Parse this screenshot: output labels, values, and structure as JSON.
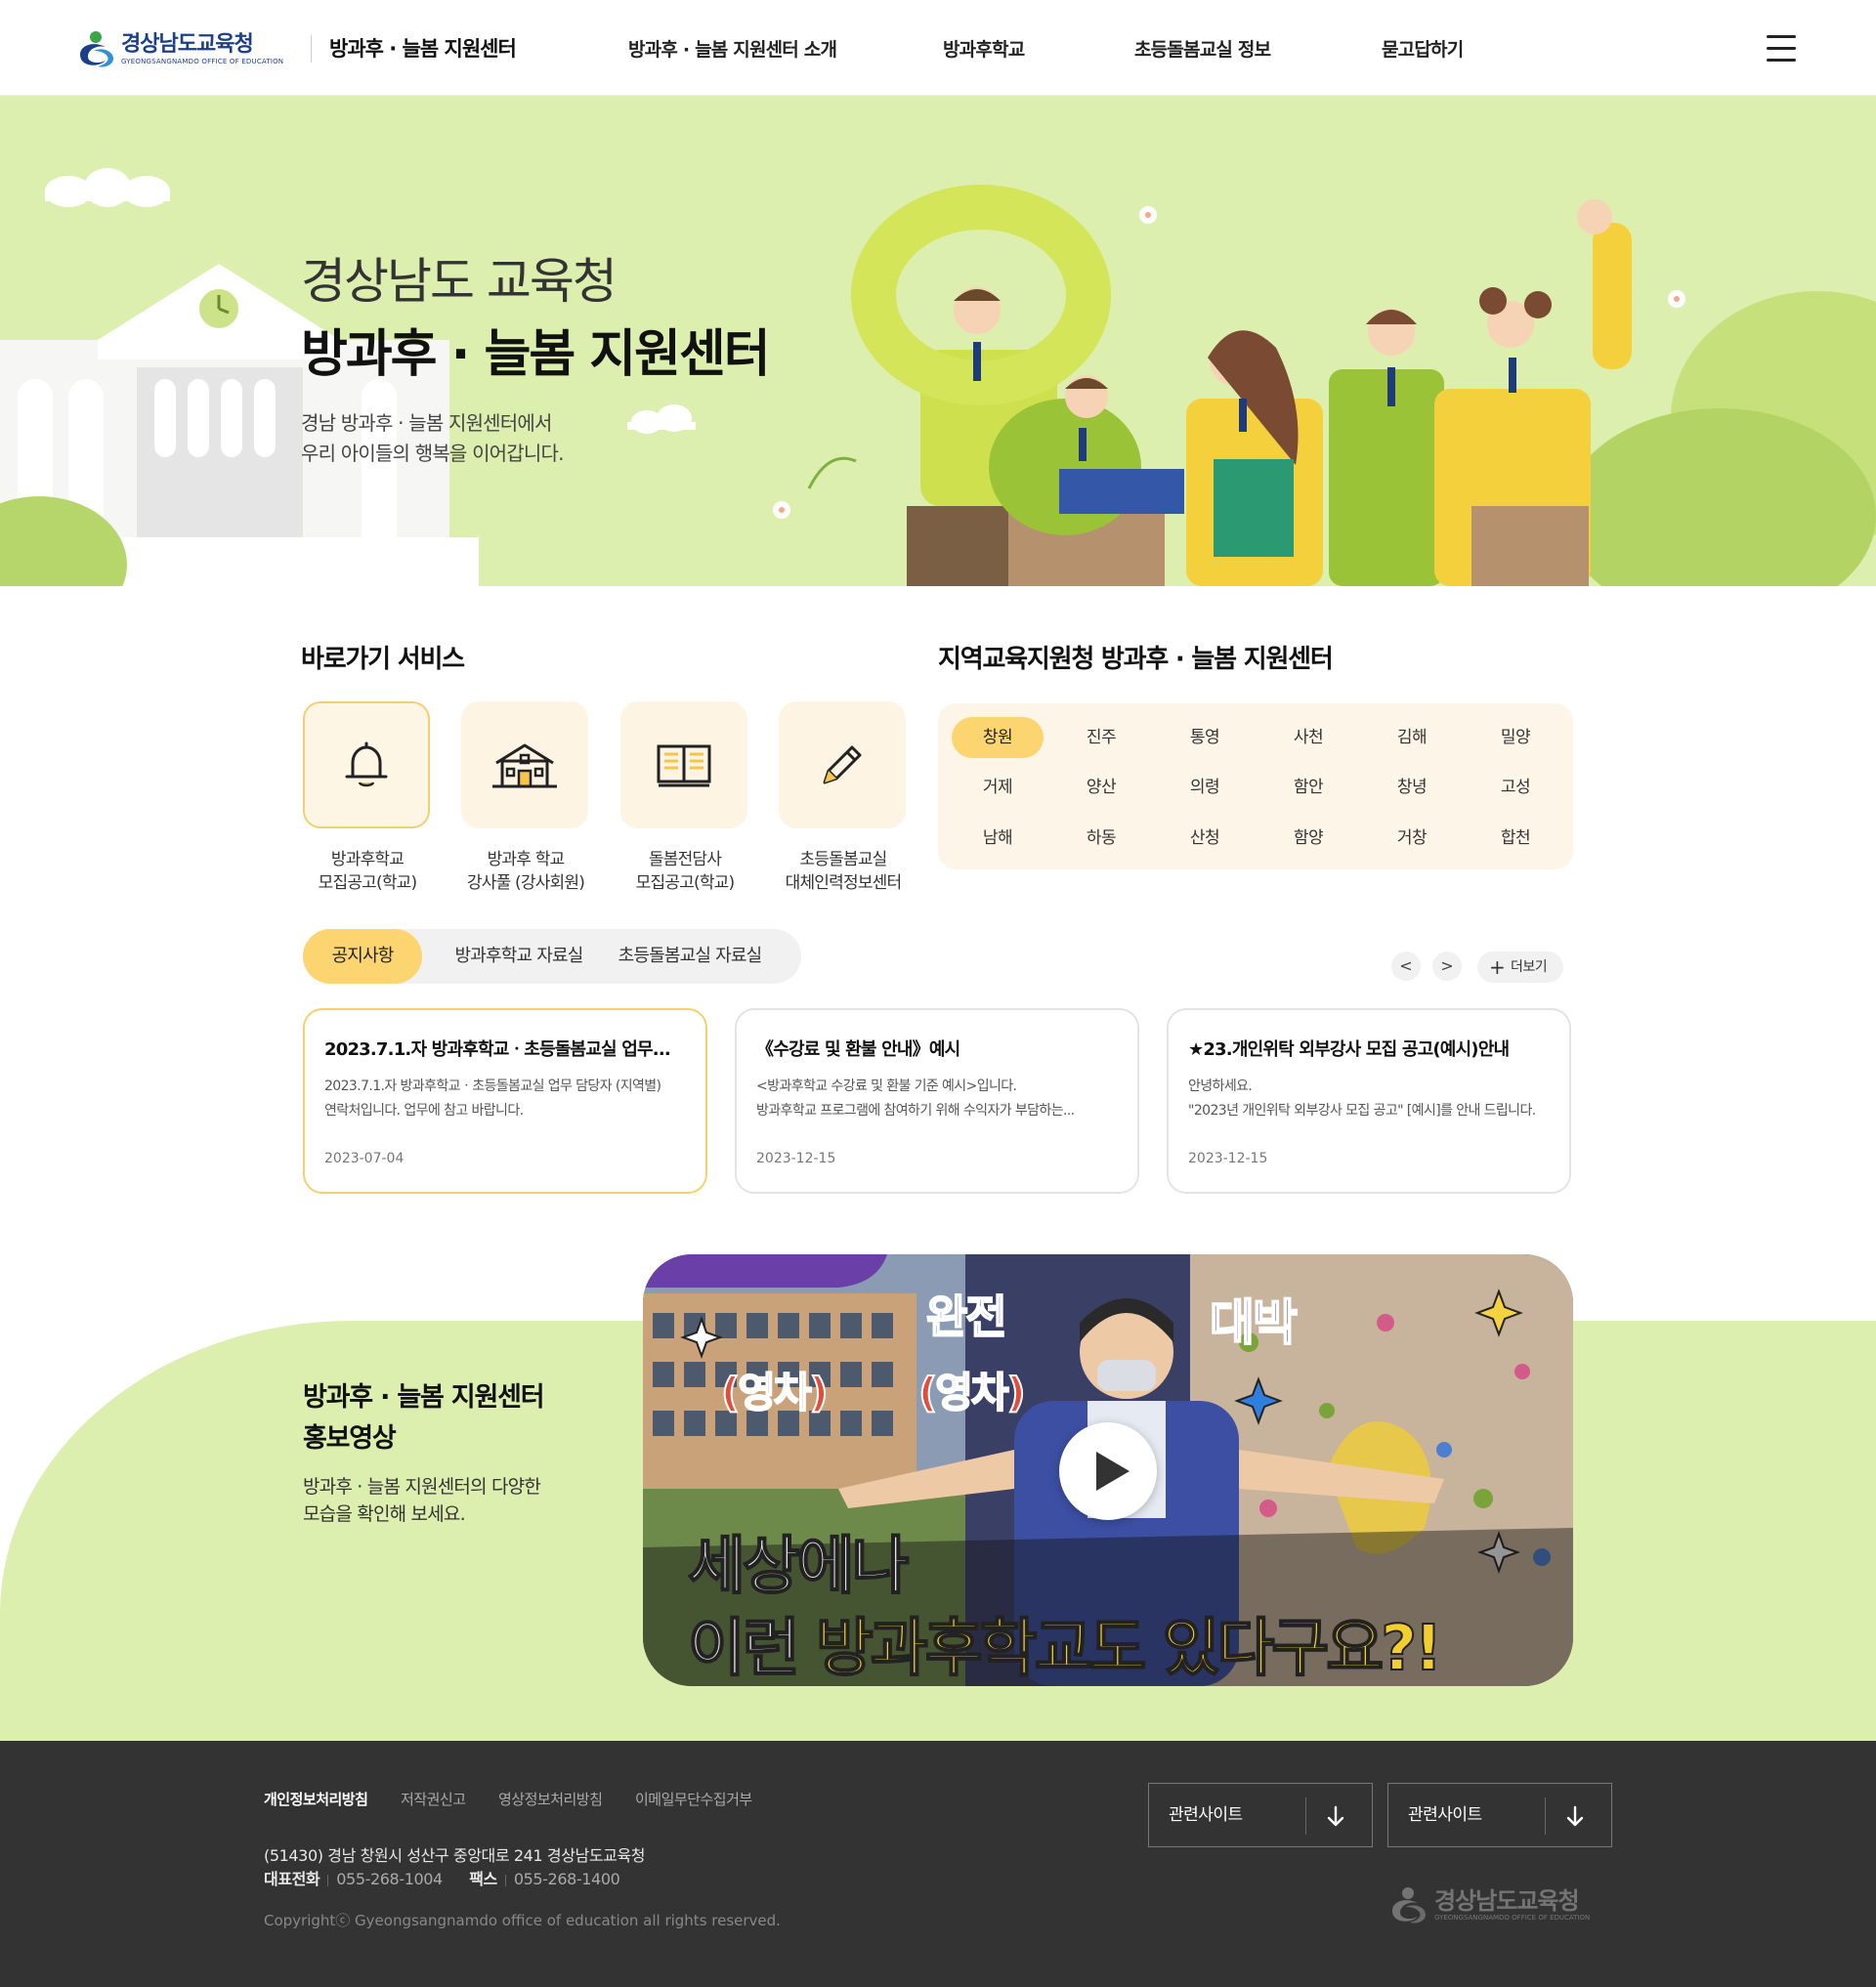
{
  "header": {
    "logo_text": "경상남도교육청",
    "logo_subtext": "GYEONGSANGNAMDO OFFICE OF EDUCATION",
    "site_title": "방과후 · 늘봄 지원센터",
    "nav": [
      "방과후 · 늘봄 지원센터 소개",
      "방과후학교",
      "초등돌봄교실 정보",
      "묻고답하기"
    ],
    "menu_icon": "hamburger-icon"
  },
  "hero": {
    "title_line1": "경상남도 교육청",
    "title_line2": "방과후 · 늘봄 지원센터",
    "desc_line1": "경남 방과후 · 늘봄 지원센터에서",
    "desc_line2": "우리 아이들의 행복을 이어갑니다.",
    "bg_color": "#dcefae"
  },
  "quick": {
    "title": "바로가기 서비스",
    "items": [
      {
        "icon": "bell-icon",
        "line1": "방과후학교",
        "line2": "모집공고(학교)"
      },
      {
        "icon": "school-icon",
        "line1": "방과후 학교",
        "line2": "강사풀 (강사회원)"
      },
      {
        "icon": "book-icon",
        "line1": "돌봄전담사",
        "line2": "모집공고(학교)"
      },
      {
        "icon": "pencil-icon",
        "line1": "초등돌봄교실",
        "line2": "대체인력정보센터"
      }
    ]
  },
  "regions": {
    "title": "지역교육지원청 방과후 · 늘봄 지원센터",
    "items": [
      "창원",
      "진주",
      "통영",
      "사천",
      "김해",
      "밀양",
      "거제",
      "양산",
      "의령",
      "함안",
      "창녕",
      "고성",
      "남해",
      "하동",
      "산청",
      "함양",
      "거창",
      "합천"
    ],
    "active": "창원",
    "accent_color": "#fcd571"
  },
  "board": {
    "tabs": [
      "공지사항",
      "방과후학교 자료실",
      "초등돌봄교실 자료실"
    ],
    "active_tab": "공지사항",
    "prev_label": "<",
    "next_label": ">",
    "more_label": "더보기",
    "cards": [
      {
        "title": "2023.7.1.자 방과후학교ㆍ초등돌봄교실 업무...",
        "body1": "2023.7.1.자 방과후학교ㆍ초등돌봄교실 업무 담당자 (지역별)",
        "body2": "연락처입니다. 업무에 참고 바랍니다.",
        "date": "2023-07-04"
      },
      {
        "title": "《수강료 및 환불 안내》예시",
        "body1": "<방과후학교 수강료 및 환불 기준 예시>입니다.",
        "body2": "방과후학교 프로그램에 참여하기 위해 수익자가 부담하는...",
        "date": "2023-12-15"
      },
      {
        "title": "★23.개인위탁 외부강사 모집 공고(예시)안내",
        "body1": "안녕하세요.",
        "body2": "\"2023년 개인위탁 외부강사 모집 공고\" [예시]를 안내 드립니다.",
        "date": "2023-12-15"
      }
    ]
  },
  "video": {
    "title_line1": "방과후 · 늘봄 지원센터",
    "title_line2": "홍보영상",
    "desc_line1": "방과후 · 늘봄 지원센터의 다양한",
    "desc_line2": "모습을 확인해 보세요.",
    "thumb_text_top_left": "완전",
    "thumb_text_top_right": "대박",
    "thumb_text_side1": "(영차)",
    "thumb_text_side2": "(영차)",
    "thumb_caption_line1": "세상에나",
    "thumb_caption_line2_a": "이런 ",
    "thumb_caption_line2_b": "방과후학교도 있다구요?!"
  },
  "footer": {
    "links": [
      "개인정보처리방침",
      "저작권신고",
      "영상정보처리방침",
      "이메일무단수집거부"
    ],
    "address": "(51430) 경남 창원시 성산구 중앙대로 241 경상남도교육청",
    "tel_label": "대표전화",
    "tel": "055-268-1004",
    "fax_label": "팩스",
    "fax": "055-268-1400",
    "copyright": "Copyrightⓒ Gyeongsangnamdo office of education all rights reserved.",
    "select1": "관련사이트",
    "select2": "관련사이트",
    "logo_text": "경상남도교육청",
    "logo_subtext": "GYEONGSANGNAMDO OFFICE OF EDUCATION"
  }
}
